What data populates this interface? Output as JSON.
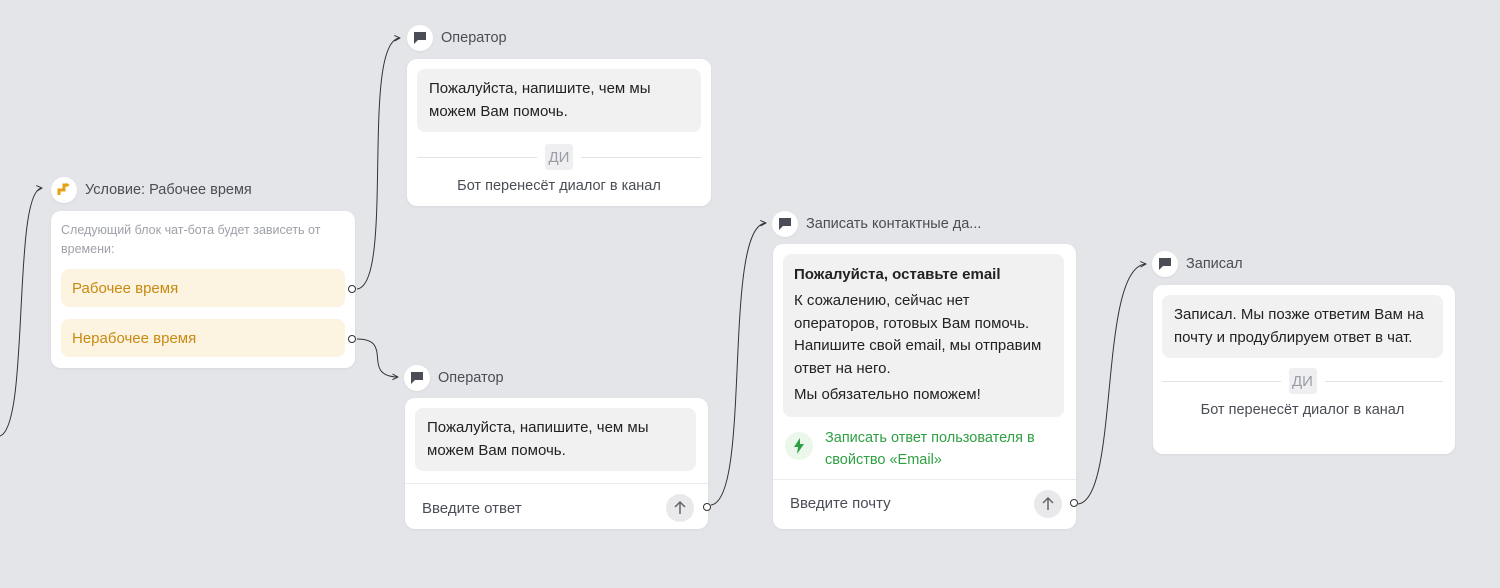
{
  "nodes": {
    "condition": {
      "title": "Условие: Рабочее время",
      "description": "Следующий блок чат-бота будет зависеть от времени:",
      "options": [
        "Рабочее время",
        "Нерабочее время"
      ]
    },
    "operator_top": {
      "title": "Оператор",
      "message": "Пожалуйста, напишите, чем мы можем Вам помочь.",
      "ai_badge": "ДИ",
      "transfer_text": "Бот перенесёт диалог в канал"
    },
    "operator_bottom": {
      "title": "Оператор",
      "message": "Пожалуйста, напишите, чем мы можем Вам помочь.",
      "input_placeholder": "Введите ответ"
    },
    "contact": {
      "title": "Записать контактные да...",
      "heading": "Пожалуйста, оставьте email",
      "body": "К сожалению, сейчас нет операторов, готовых Вам помочь. Напишите свой email, мы отправим ответ на него.",
      "closing": "Мы обязательно поможем!",
      "action": "Записать ответ пользователя в свойство «Email»",
      "input_placeholder": "Введите почту"
    },
    "recorded": {
      "title": "Записал",
      "message": "Записал. Мы позже ответим Вам на почту и продублируем ответ в чат.",
      "ai_badge": "ДИ",
      "transfer_text": "Бот перенесёт диалог в канал"
    }
  },
  "icons": {
    "chat": "chat-bubble-icon",
    "condition": "branch-icon",
    "action": "lightning-icon",
    "send": "arrow-up-icon"
  },
  "colors": {
    "canvas": "#e4e5e9",
    "option_bg": "#fdf3e1",
    "option_text": "#c88a10",
    "action_text": "#2ea043"
  }
}
